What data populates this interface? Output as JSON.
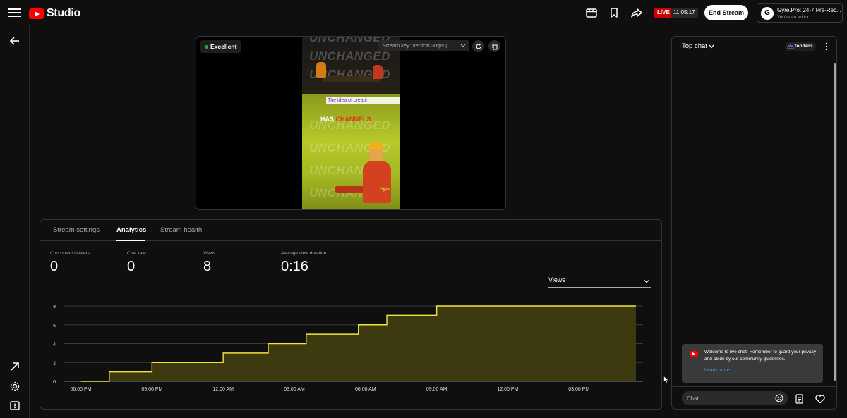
{
  "header": {
    "app_name": "Studio",
    "live_label": "LIVE",
    "live_time": "11 05:17",
    "end_stream_label": "End Stream",
    "account": {
      "avatar_letter": "G",
      "name": "Gyre.Pro: 24-7 Pre-Rec...",
      "role": "You're an editor"
    }
  },
  "preview": {
    "quality_label": "Excellent",
    "stream_key_label": "Stream key: Vertical 30fps (",
    "watermark_words": [
      "UNCHANGED",
      "UNCHANGED",
      "UNCHANGED",
      "UNCHANGED",
      "UNCHANGED",
      "UNCHANGED",
      "UNCHANGED"
    ],
    "caption_text": "The idea of creatin",
    "has_text": "HAS",
    "channels_text": "CHANNELS",
    "brand_tag": "Gyre"
  },
  "tabs": [
    {
      "label": "Stream settings"
    },
    {
      "label": "Analytics"
    },
    {
      "label": "Stream health"
    }
  ],
  "metrics": [
    {
      "label": "Concurrent viewers",
      "value": "0"
    },
    {
      "label": "Chat rate",
      "value": "0"
    },
    {
      "label": "Views",
      "value": "8"
    },
    {
      "label": "Average view duration",
      "value": "0:16"
    }
  ],
  "metric_select": {
    "selected": "Views"
  },
  "chart_data": {
    "type": "area",
    "step": true,
    "x_ticks": [
      "06:00 PM",
      "09:00 PM",
      "12:00 AM",
      "03:00 AM",
      "06:00 AM",
      "09:00 AM",
      "12:00 PM",
      "03:00 PM"
    ],
    "y_ticks": [
      "0",
      "2",
      "4",
      "6",
      "8"
    ],
    "ylim": [
      0,
      8
    ],
    "xlim_hours": [
      -0.7,
      23.7
    ],
    "series": [
      {
        "x_hours": [
          0,
          1.2,
          3.0,
          6.0,
          7.9,
          9.5,
          11.7,
          12.9,
          15.0,
          18.8,
          20.7,
          22.8,
          23.4
        ],
        "values": [
          0,
          1,
          2,
          3,
          4,
          5,
          6,
          7,
          8,
          8,
          8,
          8,
          8
        ]
      }
    ],
    "line_color": "#f1e43a",
    "fill_color": "#3d3a10",
    "grid": true
  },
  "chat": {
    "title": "Top chat",
    "top_fans_label": "Top fans",
    "welcome_message": "Welcome to live chat! Remember to guard your privacy and abide by our community guidelines.",
    "learn_more_label": "Learn more",
    "input_placeholder": "Chat..."
  },
  "icons": {
    "menu": "hamburger-icon",
    "back": "arrow-left-icon",
    "external": "arrow-up-right-icon",
    "settings": "gear-icon",
    "feedback": "feedback-icon"
  }
}
